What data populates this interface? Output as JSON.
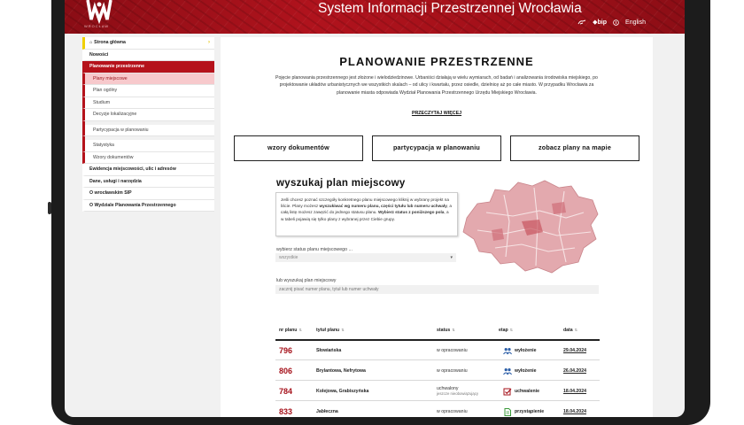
{
  "header": {
    "site_title": "System Informacji Przestrzennej Wrocławia",
    "logo_caption": "WROCŁAW",
    "bip": "bip",
    "language": "English"
  },
  "sidebar": {
    "items": [
      {
        "label": "Strona główna",
        "kind": "home"
      },
      {
        "label": "Nowości",
        "kind": "top"
      },
      {
        "label": "Planowanie przestrzenne",
        "kind": "active"
      },
      {
        "label": "Plany miejscowe",
        "kind": "current"
      },
      {
        "label": "Plan ogólny",
        "kind": "sub"
      },
      {
        "label": "Studium",
        "kind": "sub"
      },
      {
        "label": "Decyzje lokalizacyjne",
        "kind": "sub"
      },
      {
        "label": "Partycypacja w planowaniu",
        "kind": "sub"
      },
      {
        "label": "Statystyka",
        "kind": "sub"
      },
      {
        "label": "Wzory dokumentów",
        "kind": "sub"
      },
      {
        "label": "Ewidencja miejscowości, ulic i adresów",
        "kind": "top"
      },
      {
        "label": "Dane, usługi i narzędzia",
        "kind": "top"
      },
      {
        "label": "O wrocławskim SIP",
        "kind": "top"
      },
      {
        "label": "O Wydziale Planowania Przestrzennego",
        "kind": "top"
      }
    ]
  },
  "main": {
    "title": "PLANOWANIE PRZESTRZENNE",
    "intro": "Pojęcie planowania przestrzennego jest złożone i wielodziedzinowe. Urbaniści działają w wielu wymiarach, od badań i analizowania środowiska miejskiego, po projektowanie układów urbanistycznych we wszystkich skalach – od ulicy i kwartału, przez osiedle, dzielnicę aż po całe miasto. W przypadku Wrocławia za planowanie miasta odpowiada Wydział Planowania Przestrzennego Urzędu Miejskiego Wrocławia.",
    "read_more": "PRZECZYTAJ WIĘCEJ",
    "buttons": {
      "templates": "wzory dokumentów",
      "participation": "partycypacja w planowaniu",
      "map": "zobacz plany na mapie"
    },
    "search": {
      "title": "wyszukaj plan miejscowy",
      "info_parts": [
        "Jeśli chcesz poznać szczegóły konkretnego planu miejscowego kliknij w wybrany projekt na liście. Plany możesz ",
        "wyszukiwać wg numeru planu, części tytułu lub numeru uchwały",
        ", a całą listę możesz zawęzić do jednego statusu planu. ",
        "Wybierz status z poniższego pola",
        ", a w tabeli pojawią się tylko plany z wybranej przez Ciebie grupy."
      ],
      "status_label": "wybierz status planu miejscowego ...",
      "status_value": "wszystkie",
      "plan_label": "lub wyszukaj plan miejscowy",
      "plan_placeholder": "zacznij pisać numer planu, tytuł lub numer uchwały"
    },
    "table": {
      "headers": {
        "nr": "nr planu",
        "title": "tytuł planu",
        "status": "status",
        "etap": "etap",
        "date": "data"
      },
      "rows": [
        {
          "nr": "796",
          "title": "Słowiańska",
          "status": "w opracowaniu",
          "status_sub": "",
          "etap": "wyłożenie",
          "etap_icon": "people-icon",
          "date": "29.04.2024"
        },
        {
          "nr": "806",
          "title": "Brylantowa, Nefrytowa",
          "status": "w opracowaniu",
          "status_sub": "",
          "etap": "wyłożenie",
          "etap_icon": "people-icon",
          "date": "26.04.2024"
        },
        {
          "nr": "784",
          "title": "Kolejowa, Grabiszyńska",
          "status": "uchwalony",
          "status_sub": "jeszcze nieobowiązujący",
          "etap": "uchwalenie",
          "etap_icon": "checkbox-icon",
          "date": "18.04.2024"
        },
        {
          "nr": "833",
          "title": "Jabłeczna",
          "status": "w opracowaniu",
          "status_sub": "",
          "etap": "przystąpienie",
          "etap_icon": "document-icon",
          "date": "18.04.2024"
        }
      ]
    }
  },
  "colors": {
    "accent": "#b5121b",
    "header": "#a31019",
    "highlight": "#f7c9cc",
    "map_fill": "#e0a0a6"
  }
}
